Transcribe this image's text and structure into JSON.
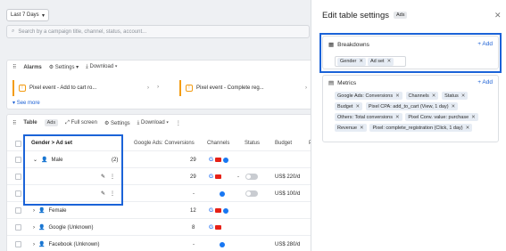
{
  "toolbar": {
    "date_range": "Last 7 Days"
  },
  "search": {
    "placeholder": "Search by a campaign title, channel, status, account..."
  },
  "alarms": {
    "title": "Alarms",
    "settings_label": "Settings",
    "download_label": "Download",
    "items": [
      {
        "label": "Pixel event - Add to cart ro..."
      },
      {
        "label": "Pixel event - Complete reg..."
      }
    ],
    "see_more": "See more"
  },
  "table": {
    "title": "Table",
    "badge": "Ads",
    "full_screen_label": "Full screen",
    "settings_label": "Settings",
    "download_label": "Download",
    "columns": {
      "group": "Gender > Ad set",
      "conversions": "Google Ads: Conversions",
      "channels": "Channels",
      "status": "Status",
      "budget": "Budget",
      "extra": "P"
    },
    "rows": [
      {
        "name": "Male",
        "count": "(2)",
        "conversions": "29",
        "budget": ""
      },
      {
        "name": "",
        "count": "",
        "conversions": "29",
        "budget": "US$ 220/d"
      },
      {
        "name": "",
        "count": "",
        "conversions": "-",
        "budget": "US$ 100/d"
      },
      {
        "name": "Female",
        "count": "",
        "conversions": "12",
        "budget": ""
      },
      {
        "name": "Google (Unknown)",
        "count": "",
        "conversions": "8",
        "budget": ""
      },
      {
        "name": "Facebook (Unknown)",
        "count": "",
        "conversions": "-",
        "budget": "US$ 280/d"
      }
    ]
  },
  "panel": {
    "title": "Edit table settings",
    "badge": "Ads",
    "breakdowns": {
      "title": "Breakdowns",
      "add_label": "+ Add",
      "chips": [
        "Gender",
        "Ad set"
      ]
    },
    "metrics": {
      "title": "Metrics",
      "add_label": "+ Add",
      "chips": [
        "Google Ads: Conversions",
        "Channels",
        "Status",
        "Budget",
        "Pixel CPA: add_to_cart (View, 1 day)",
        "Others: Total conversions",
        "Pixel Conv. value: purchase",
        "Revenue",
        "Pixel: complete_registration (Click, 1 day)"
      ]
    }
  },
  "colors": {
    "accent": "#1b63d8",
    "warning": "#f39c12"
  }
}
